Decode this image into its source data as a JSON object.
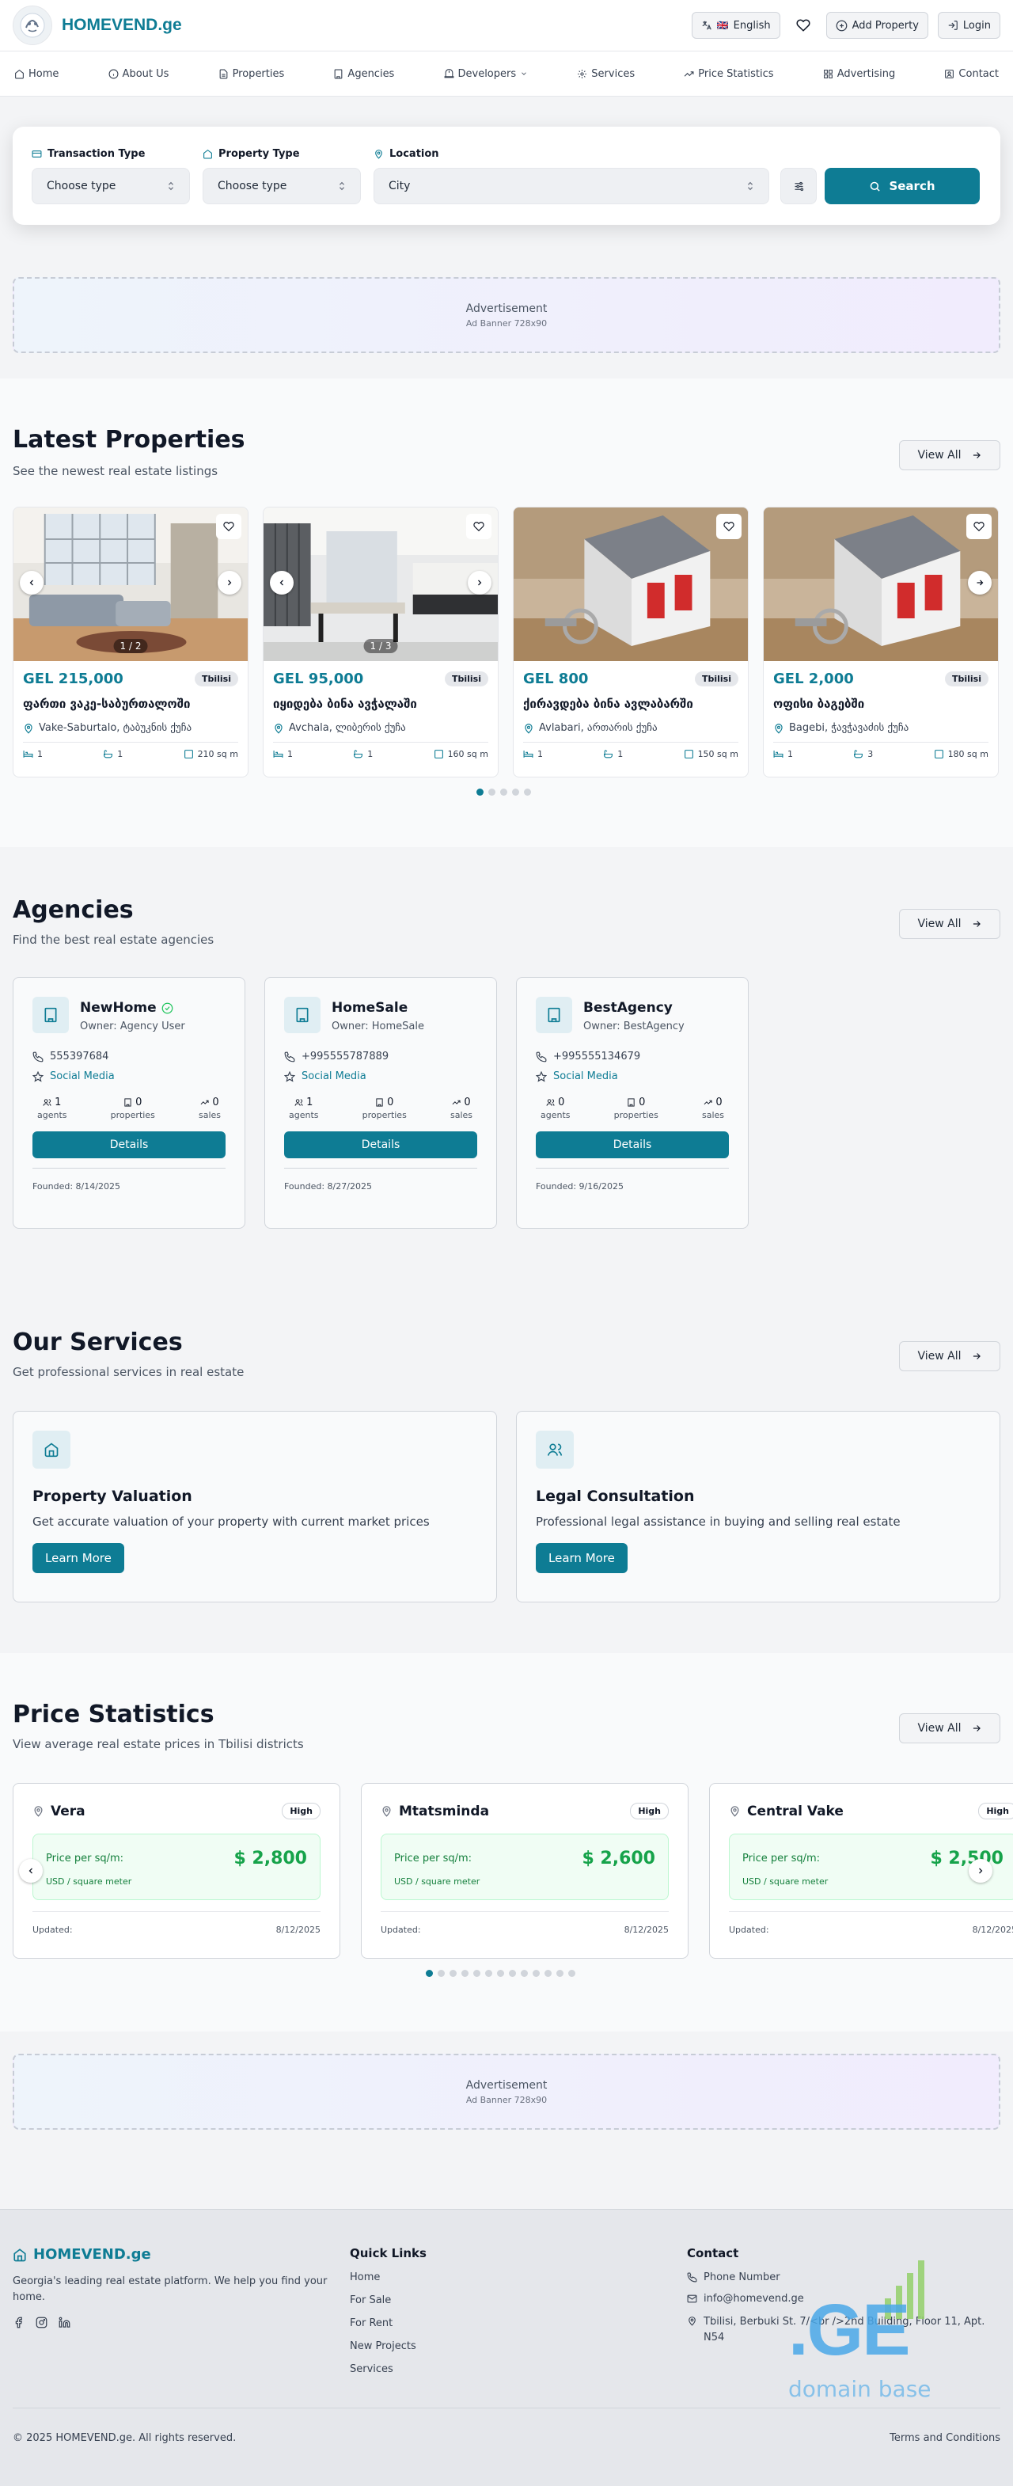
{
  "header": {
    "brand": "HOMEVEND.ge",
    "language_label": "English",
    "language_flag": "🇬🇧",
    "add_property_label": "Add Property",
    "login_label": "Login"
  },
  "nav": [
    {
      "label": "Home",
      "icon": "home-icon"
    },
    {
      "label": "About Us",
      "icon": "info-icon"
    },
    {
      "label": "Properties",
      "icon": "document-icon"
    },
    {
      "label": "Agencies",
      "icon": "building-icon"
    },
    {
      "label": "Developers",
      "icon": "crane-icon"
    },
    {
      "label": "Services",
      "icon": "gear-icon"
    },
    {
      "label": "Price Statistics",
      "icon": "trend-icon"
    },
    {
      "label": "Advertising",
      "icon": "grid-icon"
    },
    {
      "label": "Contact",
      "icon": "contact-icon"
    }
  ],
  "search": {
    "transaction_label": "Transaction Type",
    "transaction_value": "Choose type",
    "property_label": "Property Type",
    "property_value": "Choose type",
    "location_label": "Location",
    "location_value": "City",
    "search_label": "Search"
  },
  "ads": {
    "title": "Advertisement",
    "size": "Ad Banner 728x90"
  },
  "latest": {
    "title": "Latest Properties",
    "subtitle": "See the newest real estate listings",
    "view_all": "View All",
    "active_dot": 0,
    "dot_count": 5,
    "cards": [
      {
        "price": "GEL 215,000",
        "city": "Tbilisi",
        "title": "ფართი ვაკე-საბურთალოში",
        "location": "Vake-Saburtalo, ტაბუკნის ქუჩა",
        "rooms": "1",
        "baths": "1",
        "area": "210 sq m",
        "counter": "1 / 2"
      },
      {
        "price": "GEL 95,000",
        "city": "Tbilisi",
        "title": "იყიდება ბინა ავჭალაში",
        "location": "Avchala, ლიბერის ქუჩა",
        "rooms": "1",
        "baths": "1",
        "area": "160 sq m",
        "counter": "1 / 3"
      },
      {
        "price": "GEL 800",
        "city": "Tbilisi",
        "title": "ქირავდება ბინა ავლაბარში",
        "location": "Avlabari, ართარის ქუჩა",
        "rooms": "1",
        "baths": "1",
        "area": "150 sq m",
        "counter": ""
      },
      {
        "price": "GEL 2,000",
        "city": "Tbilisi",
        "title": "ოფისი ბაგებში",
        "location": "Bagebi, ჭავჭავაძის ქუჩა",
        "rooms": "1",
        "baths": "3",
        "area": "180 sq m",
        "counter": ""
      }
    ]
  },
  "agencies": {
    "title": "Agencies",
    "subtitle": "Find the best real estate agencies",
    "view_all": "View All",
    "details_label": "Details",
    "social_label": "Social Media",
    "agents_label": "agents",
    "properties_label": "properties",
    "sales_label": "sales",
    "cards": [
      {
        "name": "NewHome",
        "verified": true,
        "owner": "Owner: Agency User",
        "phone": "555397684",
        "agents": "1",
        "properties": "0",
        "sales": "0",
        "founded": "Founded: 8/14/2025"
      },
      {
        "name": "HomeSale",
        "verified": false,
        "owner": "Owner: HomeSale",
        "phone": "+995555787889",
        "agents": "1",
        "properties": "0",
        "sales": "0",
        "founded": "Founded: 8/27/2025"
      },
      {
        "name": "BestAgency",
        "verified": false,
        "owner": "Owner: BestAgency",
        "phone": "+995555134679",
        "agents": "0",
        "properties": "0",
        "sales": "0",
        "founded": "Founded: 9/16/2025"
      }
    ]
  },
  "services": {
    "title": "Our Services",
    "subtitle": "Get professional services in real estate",
    "view_all": "View All",
    "cards": [
      {
        "title": "Property Valuation",
        "desc": "Get accurate valuation of your property with current market prices",
        "button": "Learn More",
        "icon": "home-icon"
      },
      {
        "title": "Legal Consultation",
        "desc": "Professional legal assistance in buying and selling real estate",
        "button": "Learn More",
        "icon": "users-icon"
      }
    ]
  },
  "stats": {
    "title": "Price Statistics",
    "subtitle": "View average real estate prices in Tbilisi districts",
    "view_all": "View All",
    "price_label": "Price per sq/m:",
    "unit_label": "USD / square meter",
    "updated_label": "Updated:",
    "active_dot": 0,
    "dot_count": 13,
    "cards": [
      {
        "name": "Vera",
        "level": "High",
        "price": "$ 2,800",
        "updated": "8/12/2025"
      },
      {
        "name": "Mtatsminda",
        "level": "High",
        "price": "$ 2,600",
        "updated": "8/12/2025"
      },
      {
        "name": "Central Vake",
        "level": "High",
        "price": "$ 2,500",
        "updated": "8/12/2025"
      }
    ]
  },
  "footer": {
    "brand": "HOMEVEND.ge",
    "about": "Georgia's leading real estate platform. We help you find your home.",
    "quick_links_title": "Quick Links",
    "links": [
      "Home",
      "For Sale",
      "For Rent",
      "New Projects",
      "Services"
    ],
    "contact_title": "Contact",
    "phone": "Phone Number",
    "email": "info@homevend.ge",
    "address": "Tbilisi, Berbuki St. 7/<br />2nd Building, Floor 11, Apt. N54",
    "copyright": "© 2025 HOMEVEND.ge. All rights reserved.",
    "terms": "Terms and Conditions",
    "watermark_text": ".GE",
    "watermark_sub": "domain base"
  },
  "colors": {
    "accent": "#0e7c94",
    "green": "#16a34a",
    "page_bg": "#f3f4f6"
  }
}
